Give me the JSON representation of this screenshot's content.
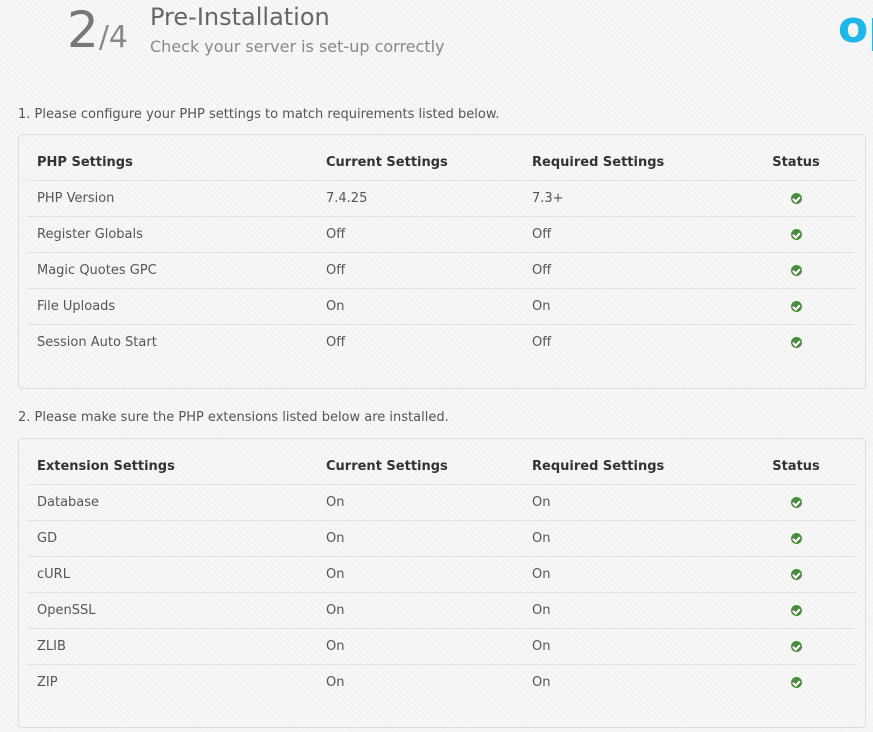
{
  "header": {
    "step_current": "2",
    "step_total": "/4",
    "title": "Pre-Installation",
    "subtitle": "Check your server is set-up correctly",
    "logo_text": "op",
    "logo_color": "#1fb6ea"
  },
  "section1": {
    "instruction": "1. Please configure your PHP settings to match requirements listed below.",
    "headers": [
      "PHP Settings",
      "Current Settings",
      "Required Settings",
      "Status"
    ],
    "rows": [
      {
        "name": "PHP Version",
        "current": "7.4.25",
        "required": "7.3+",
        "status": "check-icon"
      },
      {
        "name": "Register Globals",
        "current": "Off",
        "required": "Off",
        "status": "check-icon"
      },
      {
        "name": "Magic Quotes GPC",
        "current": "Off",
        "required": "Off",
        "status": "check-icon"
      },
      {
        "name": "File Uploads",
        "current": "On",
        "required": "On",
        "status": "check-icon"
      },
      {
        "name": "Session Auto Start",
        "current": "Off",
        "required": "Off",
        "status": "check-icon"
      }
    ]
  },
  "section2": {
    "instruction": "2. Please make sure the PHP extensions listed below are installed.",
    "headers": [
      "Extension Settings",
      "Current Settings",
      "Required Settings",
      "Status"
    ],
    "rows": [
      {
        "name": "Database",
        "current": "On",
        "required": "On",
        "status": "check-icon"
      },
      {
        "name": "GD",
        "current": "On",
        "required": "On",
        "status": "check-icon"
      },
      {
        "name": "cURL",
        "current": "On",
        "required": "On",
        "status": "check-icon"
      },
      {
        "name": "OpenSSL",
        "current": "On",
        "required": "On",
        "status": "check-icon"
      },
      {
        "name": "ZLIB",
        "current": "On",
        "required": "On",
        "status": "check-icon"
      },
      {
        "name": "ZIP",
        "current": "On",
        "required": "On",
        "status": "check-icon"
      }
    ]
  },
  "colors": {
    "status_ok": "#4a8c3f"
  }
}
